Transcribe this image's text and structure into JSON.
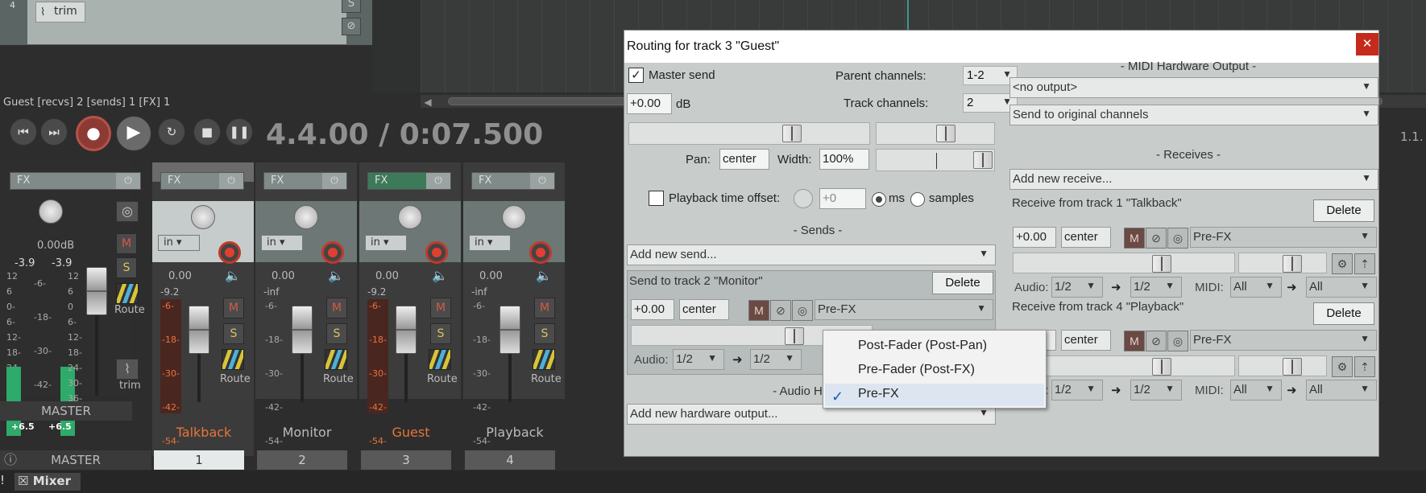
{
  "arrange": {
    "track_num": "4",
    "trim_label": "trim",
    "status": "Guest [recvs] 2 [sends] 1 [FX] 1",
    "right_num": "1.1."
  },
  "transport": {
    "time": "4.4.00 / 0:07.500"
  },
  "master": {
    "fx": "FX",
    "volume": "0.00dB",
    "peak_l": "-3.9",
    "peak_r": "-3.9",
    "scale_left": "12\n6\n0-\n6-\n12-\n18-\n24-\n30-\n36-\n42-",
    "scale_mid": "-6-\n\n-18-\n\n-30-\n\n-42-",
    "scale_right": "12\n6\n0\n6-\n12-\n18-\n24-\n30-\n36-\n42-",
    "level_l": "+6.5",
    "level_r": "+6.5",
    "m": "M",
    "s": "S",
    "route": "Route",
    "trim": "trim",
    "label": "MASTER"
  },
  "strips": [
    {
      "fx": "FX",
      "in": "in",
      "vol": "0.00",
      "peak": "-9.2",
      "m": "M",
      "s": "S",
      "route": "Route",
      "name": "Talkback",
      "num": "1",
      "name_color": "#e8743a"
    },
    {
      "fx": "FX",
      "in": "in",
      "vol": "0.00",
      "peak": "-inf",
      "m": "M",
      "s": "S",
      "route": "Route",
      "name": "Monitor",
      "num": "2",
      "name_color": "#bbbbbb"
    },
    {
      "fx": "FX",
      "in": "in",
      "vol": "0.00",
      "peak": "-9.2",
      "m": "M",
      "s": "S",
      "route": "Route",
      "name": "Guest",
      "num": "3",
      "name_color": "#e8743a"
    },
    {
      "fx": "FX",
      "in": "in",
      "vol": "0.00",
      "peak": "-inf",
      "m": "M",
      "s": "S",
      "route": "Route",
      "name": "Playback",
      "num": "4",
      "name_color": "#bbbbbb"
    }
  ],
  "scale_hot": "-6-\n\n-18-\n\n-30-\n\n-42-\n\n-54-",
  "scale_cold": "-6-\n\n-18-\n\n-30-\n\n-42-\n\n-54-",
  "bottom": {
    "tab": "Mixer",
    "bang": "!"
  },
  "dialog": {
    "title": "Routing for track 3 \"Guest\"",
    "master_send": "Master send",
    "parent_channels_label": "Parent channels:",
    "parent_channels": "1-2",
    "track_channels_label": "Track channels:",
    "track_channels": "2",
    "volume": "+0.00",
    "db": "dB",
    "pan_label": "Pan:",
    "pan": "center",
    "width_label": "Width:",
    "width": "100%",
    "playback_offset": "Playback time offset:",
    "offset_value": "+0",
    "ms": "ms",
    "samples": "samples",
    "sends_header": "-  Sends  -",
    "add_send": "Add new send...",
    "send_title": "Send to track 2 \"Monitor\"",
    "delete": "Delete",
    "send_vol": "+0.00",
    "send_pan": "center",
    "send_mode": "Pre-FX",
    "audio_label": "Audio:",
    "audio_src": "1/2",
    "audio_dst": "1/2",
    "hw_header": "-  Audio Hardware Outputs  -",
    "add_hw": "Add new hardware output...",
    "midi_hw_header": "-  MIDI Hardware Output  -",
    "midi_output": "<no output>",
    "midi_channels": "Send to original channels",
    "receives_header": "-  Receives  -",
    "add_receive": "Add new receive...",
    "recv1_title": "Receive from track 1 \"Talkback\"",
    "recv2_title": "Receive from track 4 \"Playback\"",
    "recv_vol": "+0.00",
    "recv_pan": "center",
    "recv_mode": "Pre-FX",
    "midi_label": "MIDI:",
    "midi_all": "All",
    "midi_all2": "All",
    "close": "✕"
  },
  "popup": {
    "items": [
      "Post-Fader (Post-Pan)",
      "Pre-Fader (Post-FX)",
      "Pre-FX"
    ],
    "checked": "✓"
  }
}
